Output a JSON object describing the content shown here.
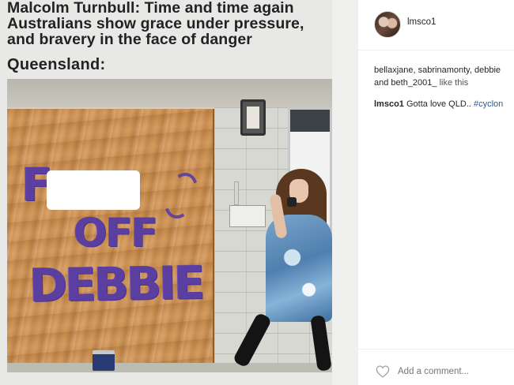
{
  "post_image": {
    "caption_lines": [
      "Malcolm Turnbull: Time and time again",
      "Australians show grace under pressure,",
      "and bravery in the face of danger"
    ],
    "subhead": "Queensland:",
    "board_text": {
      "f": "F",
      "off": "OFF",
      "debbie": "DEBBIE"
    }
  },
  "side_panel": {
    "username": "lmsco1",
    "likes_line1": "bellaxjane, sabrinamonty, debbie",
    "likes_line2_user": "and beth_2001_",
    "likes_line2_suffix": " like this",
    "comment_author": "lmsco1",
    "comment_text": " Gotta love QLD.. ",
    "comment_hashtag": "#cyclon",
    "add_comment_placeholder": "Add a comment...",
    "icons": {
      "avatar": "avatar",
      "like": "heart-icon"
    }
  }
}
